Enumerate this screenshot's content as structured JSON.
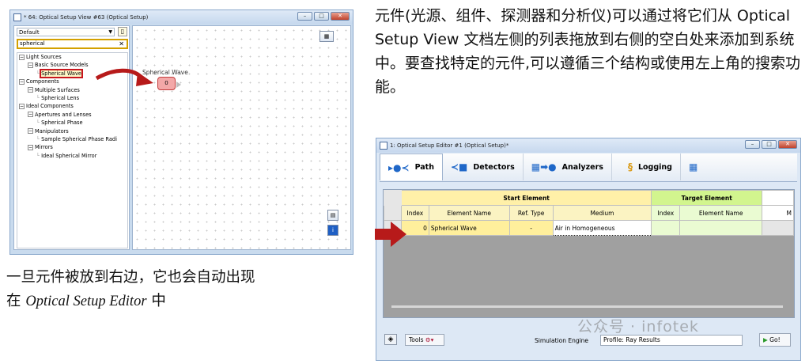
{
  "left_window": {
    "title": "* 64: Optical Setup View #63 (Optical Setup)",
    "combo_value": "Default",
    "search_value": "spherical",
    "tree": [
      {
        "label": "Light Sources",
        "indent": 0,
        "toggle": "⊟"
      },
      {
        "label": "Basic Source Models",
        "indent": 1,
        "toggle": "⊟"
      },
      {
        "label": "Spherical Wave",
        "indent": 2,
        "toggle": "",
        "highlight": true
      },
      {
        "label": "Components",
        "indent": 0,
        "toggle": "⊟"
      },
      {
        "label": "Multiple Surfaces",
        "indent": 1,
        "toggle": "⊟"
      },
      {
        "label": "Spherical Lens",
        "indent": 2,
        "toggle": ""
      },
      {
        "label": "Ideal Components",
        "indent": 0,
        "toggle": "⊟"
      },
      {
        "label": "Apertures and Lenses",
        "indent": 1,
        "toggle": "⊟"
      },
      {
        "label": "Spherical Phase",
        "indent": 2,
        "toggle": ""
      },
      {
        "label": "Manipulators",
        "indent": 1,
        "toggle": "⊟"
      },
      {
        "label": "Sample Spherical Phase Radi",
        "indent": 2,
        "toggle": ""
      },
      {
        "label": "Mirrors",
        "indent": 1,
        "toggle": "⊟"
      },
      {
        "label": "Ideal Spherical Mirror",
        "indent": 2,
        "toggle": ""
      }
    ],
    "node_label": "Spherical Wave",
    "node_index": "0"
  },
  "text_top_right": "元件(光源、组件、探测器和分析仪)可以通过将它们从 Optical Setup View 文档左侧的列表拖放到右侧的空白处来添加到系统中。要查找特定的元件,可以遵循三个结构或使用左上角的搜索功能。",
  "text_bottom_left_1": "一旦元件被放到右边，它也会自动出现",
  "text_bottom_left_2a": "在 ",
  "text_bottom_left_2b": "Optical Setup Editor",
  "text_bottom_left_2c": " 中",
  "editor": {
    "title": "1: Optical Setup Editor #1 (Optical Setup)*",
    "tabs": [
      "Path",
      "Detectors",
      "Analyzers",
      "Logging"
    ],
    "group_start": "Start Element",
    "group_target": "Target Element",
    "columns": [
      "Index",
      "Element Name",
      "Ref. Type",
      "Medium",
      "Index",
      "Element Name",
      "M"
    ],
    "row": [
      "0",
      "Spherical Wave",
      "-",
      "Air in Homogeneous",
      "",
      "",
      ""
    ],
    "tools_label": "Tools",
    "engine_label": "Simulation Engine",
    "engine_value": "Profile: Ray Results",
    "go_label": "Go!"
  },
  "watermark": "公众号 · infotek",
  "colors": {
    "highlight_red": "#c8161d",
    "start_header": "#fff0a8",
    "target_header": "#d2f58e"
  }
}
